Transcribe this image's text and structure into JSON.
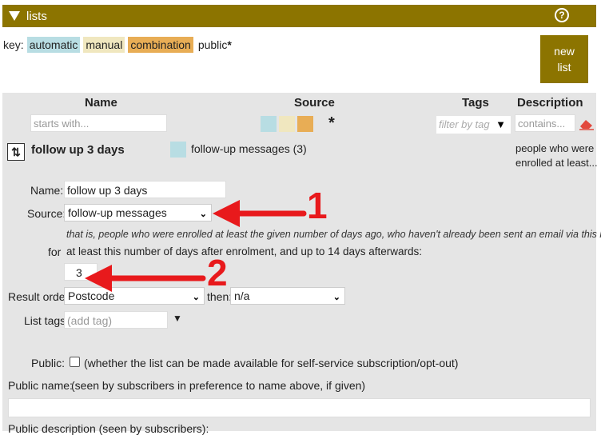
{
  "header": {
    "title": "lists",
    "help_icon": "question-circle-icon"
  },
  "key": {
    "label": "key:",
    "automatic": "automatic",
    "manual": "manual",
    "combination": "combination",
    "public": "public",
    "public_mark": "*"
  },
  "new_list_button": {
    "line1": "new",
    "line2": "list"
  },
  "table": {
    "columns": {
      "name": "Name",
      "source": "Source",
      "tags": "Tags",
      "description": "Description"
    },
    "filters": {
      "name_placeholder": "starts with...",
      "source_any": "*",
      "tags_placeholder": "filter by tag",
      "description_placeholder": "contains..."
    }
  },
  "list_row": {
    "name": "follow up 3 days",
    "source": "follow-up messages (3)",
    "description_line1": "people who were",
    "description_line2": "enrolled at least..."
  },
  "form": {
    "name_label": "Name:",
    "name_value": "follow up 3 days",
    "source_label": "Source:",
    "source_value": "follow-up messages",
    "explain": "that is, people who were enrolled at least the given number of days ago, who haven't already been sent an email via this list",
    "for_label": "for",
    "for_text": "at least this number of days after enrolment, and up to 14 days afterwards:",
    "days_value": "3",
    "result_order_label": "Result order:",
    "result_order_value": "Postcode",
    "then_label": "then:",
    "then_value": "n/a",
    "list_tags_label": "List tags:",
    "list_tags_placeholder": "(add tag)",
    "public_label": "Public:",
    "public_text": "(whether the list can be made available for self-service subscription/opt-out)",
    "public_name_label": "Public name:",
    "public_name_text": "(seen by subscribers in preference to name above, if given)",
    "public_desc_label": "Public description (seen by subscribers):"
  },
  "annotations": {
    "arrow1": "1",
    "arrow2": "2"
  },
  "colors": {
    "bar": "#8c7400",
    "automatic": "#b8dde3",
    "manual": "#f0e7bf",
    "combination": "#e8ad55",
    "arrow": "#e8191c"
  }
}
